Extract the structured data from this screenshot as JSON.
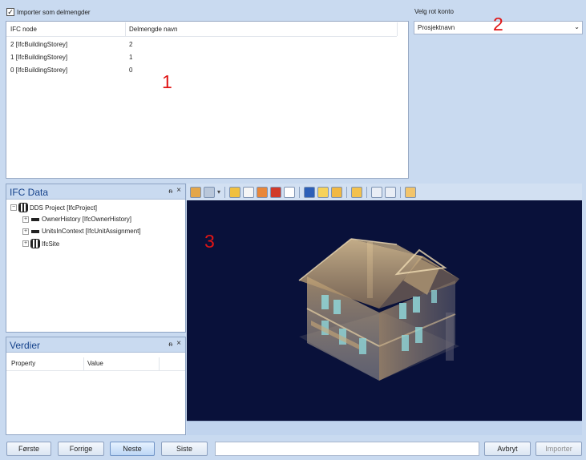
{
  "import_option": {
    "label": "Importer som delmengder",
    "checked": true,
    "check_glyph": "✓"
  },
  "grid": {
    "columns": [
      "IFC node",
      "Delmengde navn"
    ],
    "rows": [
      [
        "2 [IfcBuildingStorey]",
        "2"
      ],
      [
        "1 [IfcBuildingStorey]",
        "1"
      ],
      [
        "0 [IfcBuildingStorey]",
        "0"
      ]
    ]
  },
  "account": {
    "label": "Velg rot konto",
    "value": "Prosjektnavn",
    "arrow": "⌄"
  },
  "annotations": {
    "one": "1",
    "two": "2",
    "three": "3"
  },
  "ifc_panel": {
    "title": "IFC Data",
    "pin": "ᵰ",
    "close": "×",
    "tree": {
      "root": "DDS Project [IfcProject]",
      "children": [
        "OwnerHistory [IfcOwnerHistory]",
        "UnitsInContext [IfcUnitAssignment]",
        "IfcSite"
      ],
      "collapse_glyph": "−",
      "expand_glyph": "+"
    }
  },
  "values_panel": {
    "title": "Verdier",
    "pin": "ᵰ",
    "close": "×",
    "columns": [
      "Property",
      "Value"
    ]
  },
  "viewer": {
    "background": "#09113a",
    "toolbar_icons": [
      "home-icon",
      "pan-icon",
      "dropdown-icon",
      "section-icon",
      "hierarchy-icon",
      "color-icon",
      "material-icon",
      "box-icon",
      "plane-icon",
      "label-icon",
      "measure-icon",
      "ruler-icon",
      "fit-icon",
      "frame-icon",
      "axis-icon"
    ]
  },
  "buttons": {
    "first": "Første",
    "previous": "Forrige",
    "next": "Neste",
    "last": "Siste",
    "cancel": "Avbryt",
    "import": "Importer"
  },
  "colors": {
    "accent": "#15428b",
    "annotation": "#e01515",
    "chrome": "#c9daf0"
  }
}
